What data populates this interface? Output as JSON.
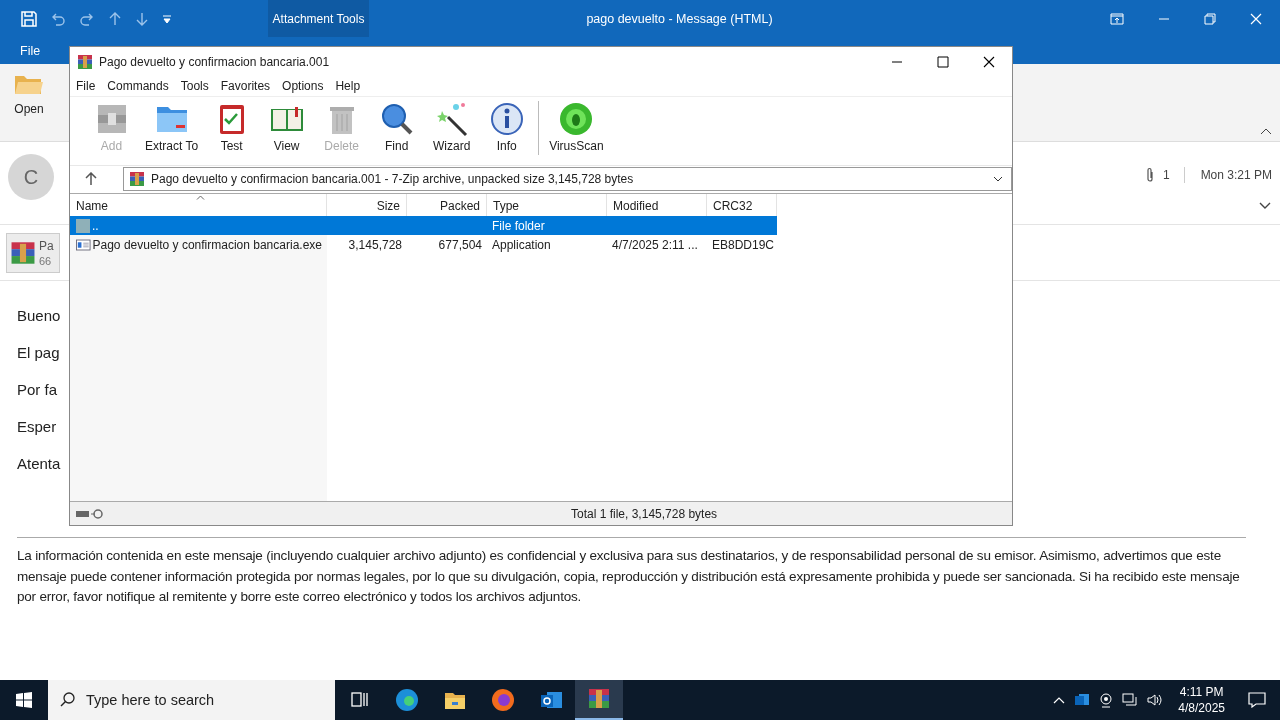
{
  "outlook": {
    "title": "pago devuelto  -  Message (HTML)",
    "contextual_tab": "Attachment Tools",
    "tabs": [
      {
        "label": "File"
      }
    ],
    "ribbon": [
      {
        "label": "Open"
      }
    ],
    "sender_initial": "C",
    "attachment": {
      "name": "Pa",
      "size": "66"
    },
    "attachment_count": "1",
    "date": "Mon 3:21 PM",
    "body_lines": [
      "Bueno",
      "El pag",
      "Por fa",
      "Esper",
      "Atenta"
    ],
    "disclaimer": "La información contenida en este mensaje (incluyendo cualquier archivo adjunto) es confidencial y exclusiva para sus destinatarios, y de responsabilidad personal de su emisor. Asimismo, advertimos que este mensaje puede contener información protegida por normas legales, por lo que su divulgación, copia, reproducción y distribución está expresamente prohibida y puede ser sancionada. Si ha recibido este mensaje por error, favor notifique al remitente y borre este correo electrónico y todos los archivos adjuntos."
  },
  "winrar": {
    "title": "Pago devuelto y confirmacion bancaria.001",
    "menu": [
      "File",
      "Commands",
      "Tools",
      "Favorites",
      "Options",
      "Help"
    ],
    "toolbar_groups": [
      {
        "items": [
          {
            "kind": "add",
            "label": "Add",
            "disabled": true
          },
          {
            "kind": "extract",
            "label": "Extract To",
            "disabled": false
          },
          {
            "kind": "test",
            "label": "Test",
            "disabled": false
          },
          {
            "kind": "view",
            "label": "View",
            "disabled": false
          },
          {
            "kind": "delete",
            "label": "Delete",
            "disabled": true
          },
          {
            "kind": "find",
            "label": "Find",
            "disabled": false
          },
          {
            "kind": "wizard",
            "label": "Wizard",
            "disabled": false
          },
          {
            "kind": "info",
            "label": "Info",
            "disabled": false
          }
        ]
      },
      {
        "items": [
          {
            "kind": "virusscan",
            "label": "VirusScan",
            "disabled": false
          }
        ]
      }
    ],
    "address": "Pago devuelto y confirmacion bancaria.001 - 7-Zip archive, unpacked size 3,145,728 bytes",
    "columns": [
      {
        "label": "Name"
      },
      {
        "label": "Size"
      },
      {
        "label": "Packed"
      },
      {
        "label": "Type"
      },
      {
        "label": "Modified"
      },
      {
        "label": "CRC32"
      }
    ],
    "rows": [
      {
        "kind": "folder",
        "selected": true,
        "cells": [
          "..",
          "",
          "",
          "File folder",
          "",
          ""
        ]
      },
      {
        "kind": "file",
        "selected": false,
        "cells": [
          "Pago devuelto y confirmacion bancaria.exe",
          "3,145,728",
          "677,504",
          "Application",
          "4/7/2025 2:11 ...",
          "EB8DD19C"
        ]
      }
    ],
    "status": "Total 1 file, 3,145,728 bytes"
  },
  "taskbar": {
    "search_placeholder": "Type here to search",
    "time": "4:11 PM",
    "date": "4/8/2025",
    "apps": [
      {
        "kind": "taskview",
        "selected": false
      },
      {
        "kind": "edge",
        "selected": false
      },
      {
        "kind": "explorer",
        "selected": false
      },
      {
        "kind": "firefox",
        "selected": false
      },
      {
        "kind": "outlook",
        "selected": false
      },
      {
        "kind": "winrar",
        "selected": true
      }
    ]
  }
}
